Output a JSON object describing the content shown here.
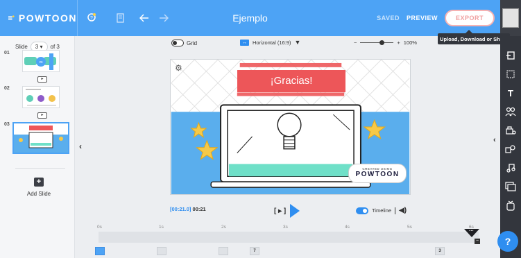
{
  "app": {
    "logo": "POWTOON",
    "title": "Ejemplo",
    "saved": "SAVED",
    "preview": "PREVIEW",
    "export": "EXPORT",
    "tooltip": "Upload, Download or Share",
    "help": "?"
  },
  "slides": {
    "label": "Slide",
    "current": "3",
    "total": "of 3",
    "items": [
      {
        "num": "01"
      },
      {
        "num": "02"
      },
      {
        "num": "03"
      }
    ],
    "add_label": "Add Slide"
  },
  "toolbar": {
    "grid_label": "Grid",
    "ratio_label": "Horizontal (16:9)",
    "zoom_minus": "−",
    "zoom_plus": "+",
    "zoom_value": "100%"
  },
  "canvas": {
    "banner_text": "¡Gracias!",
    "badge_small": "CREATED USING",
    "badge_big": "POWTOON"
  },
  "playback": {
    "current_time": "[00:21.0]",
    "total_time": "00:21",
    "frame_btn": "[ ▸ ]",
    "timeline_label": "Timeline"
  },
  "timeline": {
    "ticks": [
      "0s",
      "1s",
      "2s",
      "3s",
      "4s",
      "5s",
      "6s"
    ],
    "items": [
      "",
      "",
      "",
      "7",
      "3"
    ]
  },
  "colors": {
    "topbar": "#4da3f5",
    "accent": "#2f8ef0",
    "banner": "#ed5659",
    "sidebar_dark": "#33363d"
  },
  "icons": [
    "lightbulb-icon",
    "notes-icon",
    "undo-icon",
    "redo-icon",
    "text-icon",
    "characters-icon",
    "props-icon",
    "shapes-icon",
    "music-icon",
    "media-icon",
    "background-icon",
    "settings-icon",
    "play-icon",
    "volume-icon"
  ]
}
